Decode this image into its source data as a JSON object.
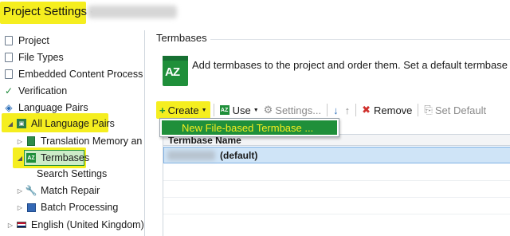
{
  "window": {
    "title": "Project Settings -"
  },
  "tree": {
    "items": [
      {
        "label": "Project"
      },
      {
        "label": "File Types"
      },
      {
        "label": "Embedded Content Process"
      },
      {
        "label": "Verification"
      },
      {
        "label": "Language Pairs"
      },
      {
        "label": "All Language Pairs"
      },
      {
        "label": "Translation Memory an"
      },
      {
        "label": "Termbases"
      },
      {
        "label": "Search Settings"
      },
      {
        "label": "Match Repair"
      },
      {
        "label": "Batch Processing"
      },
      {
        "label": "English (United Kingdom)"
      }
    ]
  },
  "main": {
    "section_title": "Termbases",
    "icon_label": "AZ",
    "description": "Add termbases to the project and order them. Set a default termbase"
  },
  "toolbar": {
    "create_label": "Create",
    "use_label": "Use",
    "settings_label": "Settings...",
    "remove_label": "Remove",
    "set_default_label": "Set Default"
  },
  "dropdown": {
    "items": [
      {
        "label": "New File-based Termbase ..."
      }
    ]
  },
  "grid": {
    "header": "Termbase Name",
    "rows": [
      {
        "suffix": "(default)"
      }
    ]
  },
  "colors": {
    "highlight": "#f5ee1f",
    "accent_green": "#1f8f3a",
    "selection_blue": "#cfe4f7"
  }
}
